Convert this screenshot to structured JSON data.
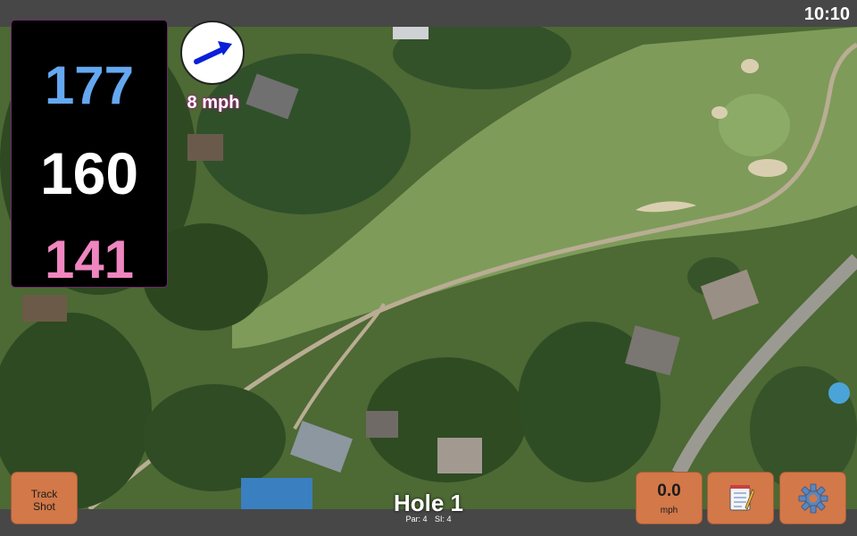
{
  "status": {
    "time": "10:10"
  },
  "yardages": {
    "back": "177",
    "center": "160",
    "front": "141"
  },
  "wind": {
    "label": "8 mph",
    "icon": "wind-direction-arrow-icon"
  },
  "buttons": {
    "track_shot": [
      "Track",
      "Shot"
    ],
    "speed_value": "0.0",
    "speed_unit": "mph",
    "notes_icon": "notepad-icon",
    "settings_icon": "gear-icon"
  },
  "hole": {
    "title": "Hole 1",
    "par": "Par: 4",
    "si": "SI: 4"
  },
  "colors": {
    "back_yardage": "#64a8f0",
    "center_yardage": "#ffffff",
    "front_yardage": "#ef86c0",
    "button_bg": "#d27849",
    "bar_bg": "#474747",
    "wind_arrow": "#0b1fd8"
  }
}
